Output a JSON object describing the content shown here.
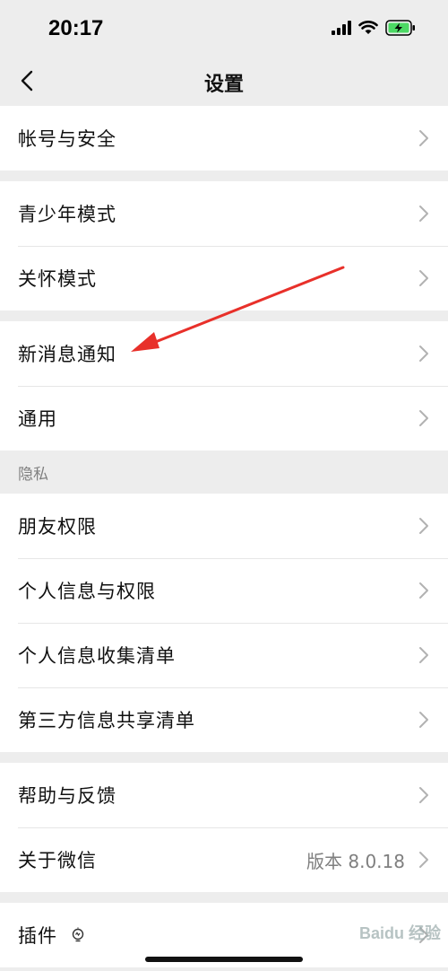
{
  "status": {
    "time": "20:17"
  },
  "nav": {
    "title": "设置"
  },
  "groups": [
    {
      "items": [
        {
          "label": "帐号与安全"
        }
      ]
    },
    {
      "items": [
        {
          "label": "青少年模式"
        },
        {
          "label": "关怀模式"
        }
      ]
    },
    {
      "items": [
        {
          "label": "新消息通知"
        },
        {
          "label": "通用"
        }
      ]
    },
    {
      "section": "隐私",
      "items": [
        {
          "label": "朋友权限"
        },
        {
          "label": "个人信息与权限"
        },
        {
          "label": "个人信息收集清单"
        },
        {
          "label": "第三方信息共享清单"
        }
      ]
    },
    {
      "items": [
        {
          "label": "帮助与反馈"
        },
        {
          "label": "关于微信",
          "value": "版本 8.0.18"
        }
      ]
    },
    {
      "items": [
        {
          "label": "插件"
        }
      ]
    }
  ],
  "watermark": "Baidu 经验",
  "colors": {
    "annotation_arrow": "#e8302a",
    "battery": "#4cd964"
  }
}
